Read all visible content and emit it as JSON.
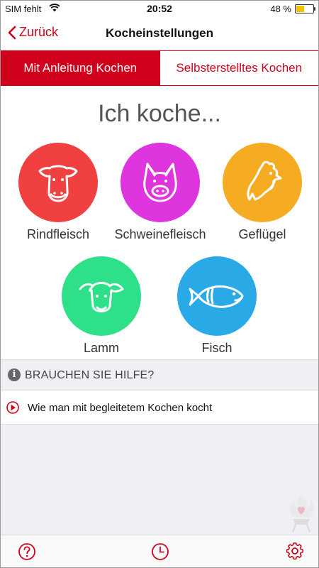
{
  "status_bar": {
    "carrier": "SIM fehlt",
    "time": "20:52",
    "battery_percent": "48 %",
    "battery_level": 0.48,
    "battery_color": "#f3c300"
  },
  "nav": {
    "back_label": "Zurück",
    "title": "Kocheinstellungen"
  },
  "tabs": [
    {
      "label": "Mit Anleitung Kochen",
      "active": true
    },
    {
      "label": "Selbsterstelltes Kochen",
      "active": false
    }
  ],
  "main": {
    "heading": "Ich koche..."
  },
  "animals": [
    {
      "label": "Rindfleisch",
      "color": "#f04040",
      "icon": "cow-icon"
    },
    {
      "label": "Schweinefleisch",
      "color": "#de35de",
      "icon": "pig-icon"
    },
    {
      "label": "Geflügel",
      "color": "#f6ac22",
      "icon": "chicken-icon"
    },
    {
      "label": "Lamm",
      "color": "#2ee08a",
      "icon": "sheep-icon"
    },
    {
      "label": "Fisch",
      "color": "#29aae7",
      "icon": "fish-icon"
    }
  ],
  "help": {
    "header": "BRAUCHEN SIE HILFE?",
    "items": [
      {
        "label": "Wie man mit begleitetem Kochen kocht",
        "icon": "play-icon"
      }
    ]
  },
  "tab_bar": {
    "items": [
      {
        "icon": "help-icon"
      },
      {
        "icon": "timer-icon"
      },
      {
        "icon": "settings-icon"
      }
    ]
  },
  "colors": {
    "accent": "#d0021b"
  }
}
